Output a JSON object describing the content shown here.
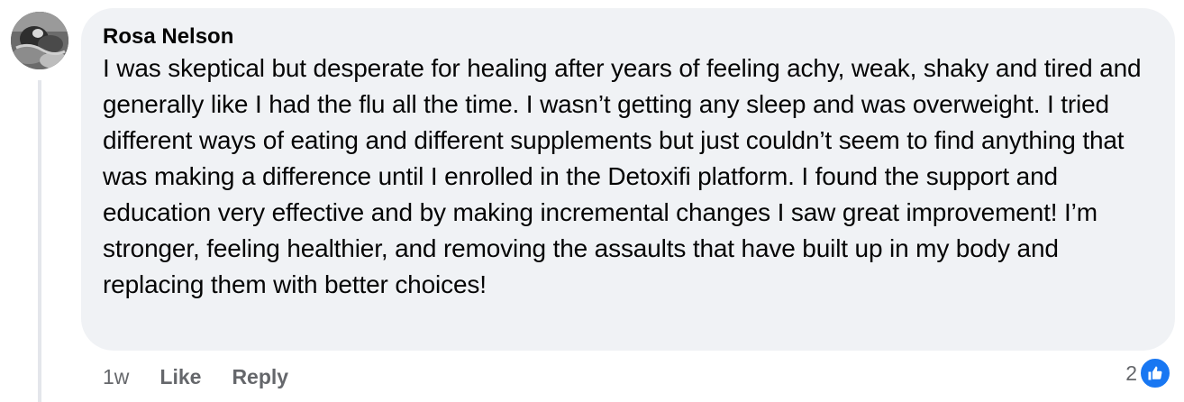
{
  "comment": {
    "author": "Rosa Nelson",
    "text": "I was skeptical but desperate for healing after years of feeling achy, weak, shaky and tired and generally like I had the flu all the time. I wasn’t getting any sleep and was overweight. I tried different ways of eating and different supplements but just couldn’t seem to find anything that was making a difference until I enrolled in the Detoxifi platform. I found the support and education very effective and by making incremental changes I saw great improvement! I’m stronger, feeling healthier, and removing the assaults that have built up in my body and replacing them with better choices!",
    "time": "1w",
    "like_label": "Like",
    "reply_label": "Reply",
    "reaction_count": "2",
    "reaction_icon": "like-icon"
  },
  "colors": {
    "bubble_bg": "#f0f2f5",
    "text": "#050505",
    "secondary_text": "#65676b",
    "like_blue": "#1877f2"
  }
}
